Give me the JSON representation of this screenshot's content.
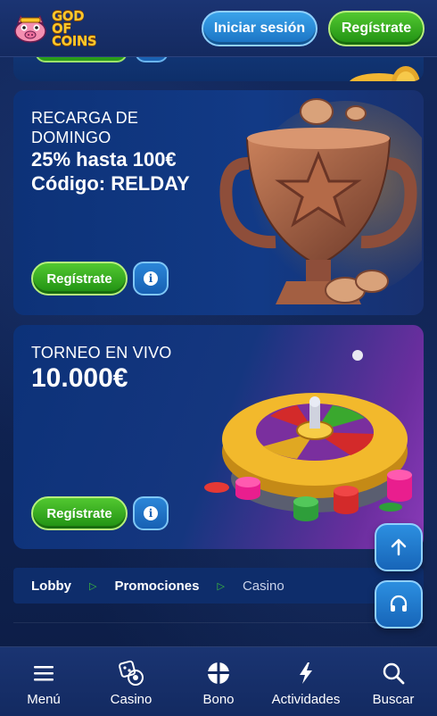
{
  "header": {
    "logo_text_line1": "GOD OF",
    "logo_text_line2": "COINS",
    "login_label": "Iniciar sesión",
    "register_label": "Regístrate"
  },
  "promos": [
    {
      "line1": "RECARGA DE",
      "line2": "DOMINGO",
      "highlight": "25% hasta 100€",
      "code": "Código: RELDAY",
      "cta": "Regístrate",
      "info_icon": "i"
    },
    {
      "line1": "TORNEO EN VIVO",
      "highlight": "10.000€",
      "cta": "Regístrate",
      "info_icon": "i"
    }
  ],
  "breadcrumb": {
    "items": [
      "Lobby",
      "Promociones",
      "Casino"
    ],
    "separator": "▷"
  },
  "fabs": {
    "scroll_top_icon": "arrow-up-icon",
    "support_icon": "headset-icon"
  },
  "bottom_nav": [
    {
      "label": "Menú",
      "icon": "hamburger-icon"
    },
    {
      "label": "Casino",
      "icon": "dice-icon"
    },
    {
      "label": "Bono",
      "icon": "gift-icon"
    },
    {
      "label": "Actividades",
      "icon": "lightning-icon"
    },
    {
      "label": "Buscar",
      "icon": "search-icon"
    }
  ],
  "colors": {
    "primary_green": "#2a9d1a",
    "primary_blue": "#1a72c3",
    "background": "#0d1f4a",
    "accent_gold": "#ffc72a"
  }
}
